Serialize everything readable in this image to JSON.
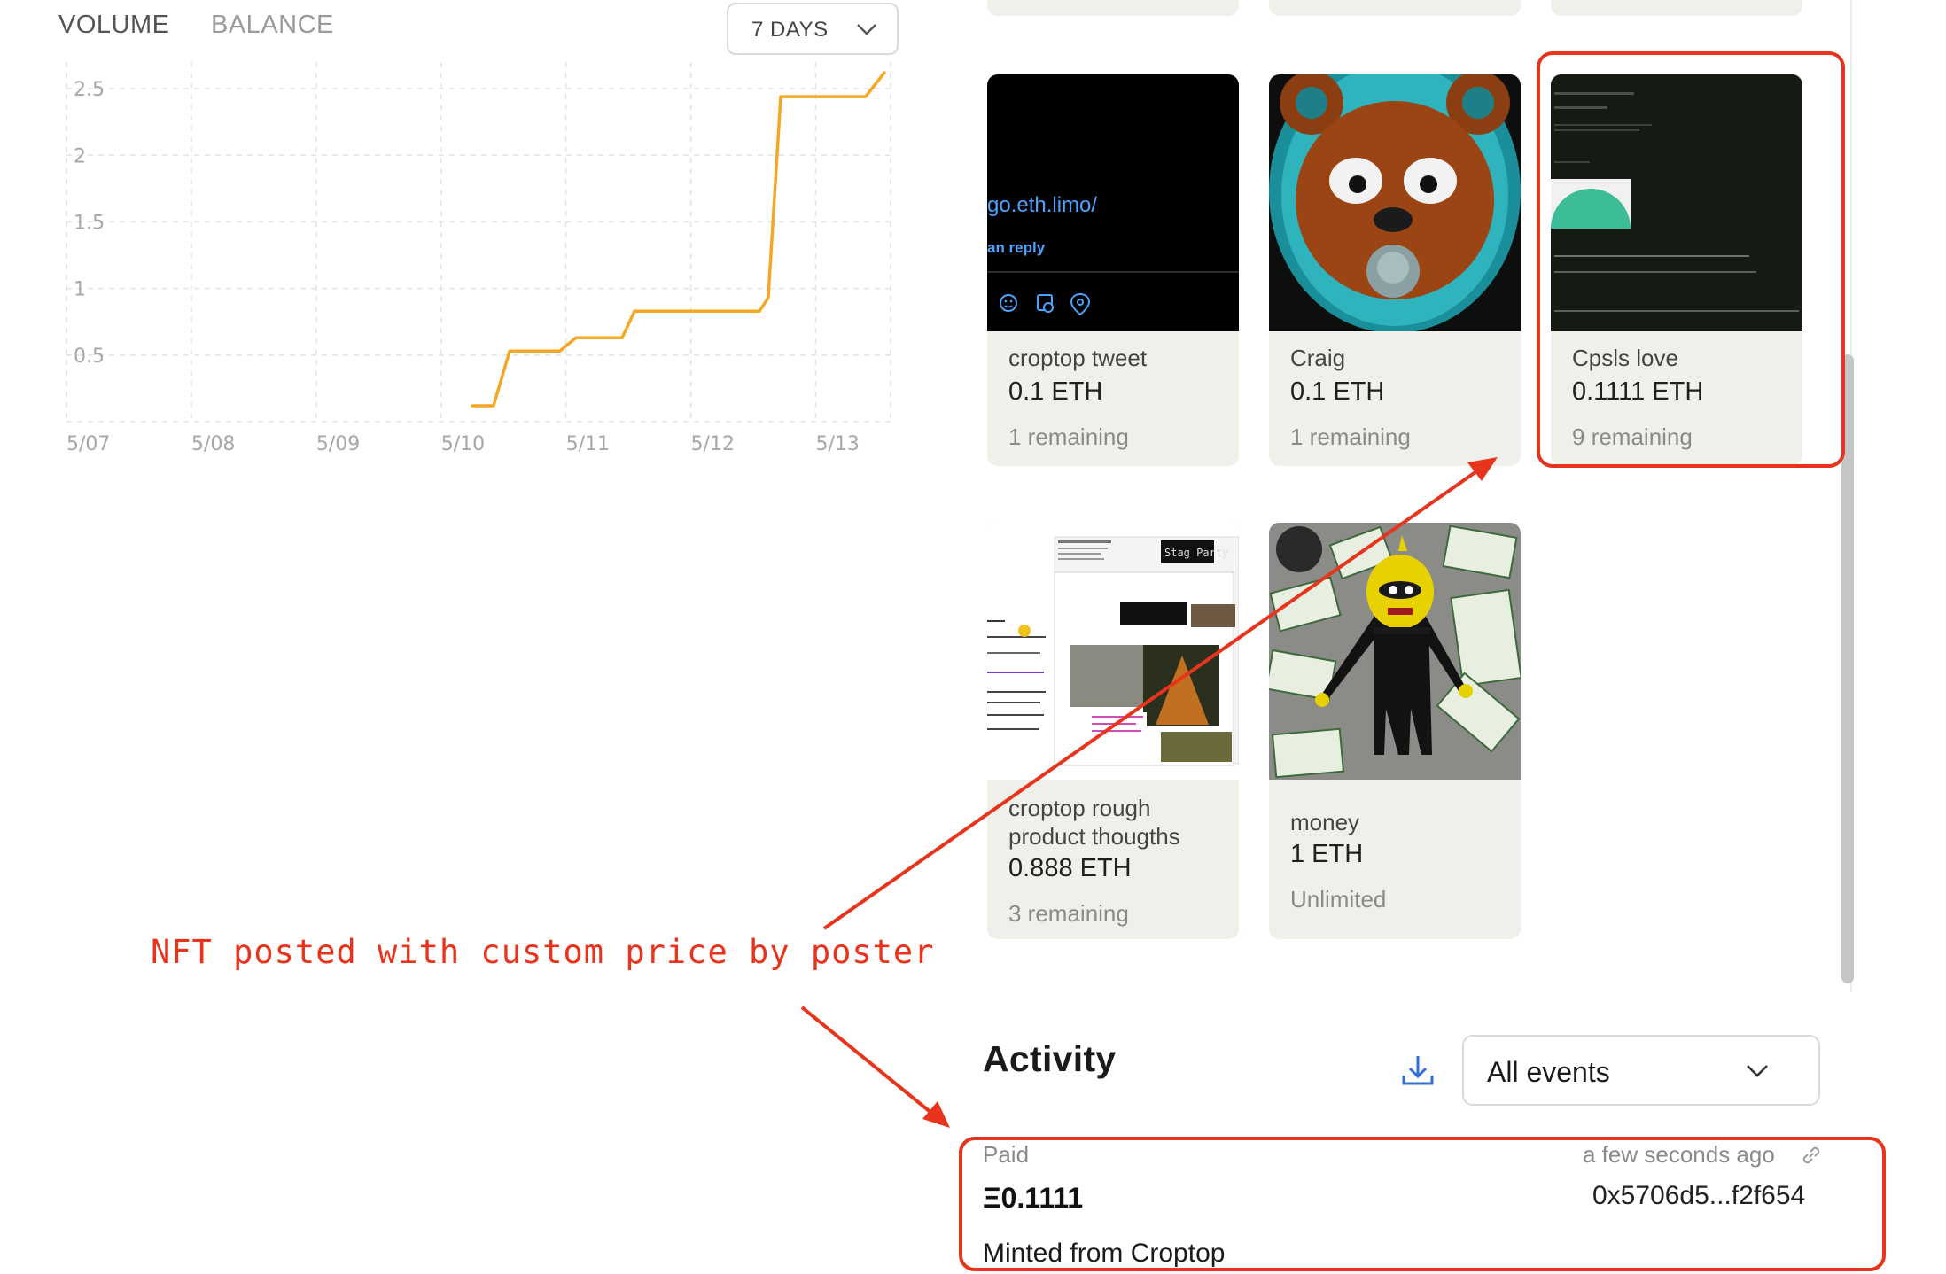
{
  "chart_panel": {
    "tabs": [
      {
        "label": "VOLUME"
      },
      {
        "label": "BALANCE"
      }
    ],
    "range": "7 DAYS"
  },
  "chart_data": {
    "type": "line",
    "title": "",
    "xlabel": "",
    "ylabel": "",
    "x_tick_labels": [
      "5/07",
      "5/08",
      "5/09",
      "5/10",
      "5/11",
      "5/12",
      "5/13"
    ],
    "y_ticks": [
      0.5,
      1,
      1.5,
      2,
      2.5
    ],
    "y_tick_labels": [
      "0.5",
      "1",
      "1.5",
      "2",
      "2.5"
    ],
    "xlim": [
      0,
      6.6
    ],
    "ylim": [
      0,
      2.7
    ],
    "grid": true,
    "line_color": "#f5a623",
    "series": [
      {
        "x": [
          3.25,
          3.42,
          3.55,
          3.95,
          4.08,
          4.45,
          4.55,
          5.55,
          5.62,
          5.72,
          6.4,
          6.55
        ],
        "y": [
          0.12,
          0.12,
          0.53,
          0.53,
          0.63,
          0.63,
          0.83,
          0.83,
          0.93,
          2.44,
          2.44,
          2.62
        ]
      }
    ]
  },
  "nft_grid": {
    "cards": [
      {
        "name": "croptop tweet",
        "price": "0.1 ETH",
        "remaining": "1 remaining",
        "thumb_url_text": "go.eth.limo/",
        "thumb_reply_text": "an reply"
      },
      {
        "name": "Craig",
        "price": "0.1 ETH",
        "remaining": "1 remaining"
      },
      {
        "name": "Cpsls love",
        "price": "0.1111 ETH",
        "remaining": "9 remaining"
      },
      {
        "name": "croptop rough product thougths",
        "price": "0.888 ETH",
        "remaining": "3 remaining",
        "thumb_banner_text": "Stag Party"
      },
      {
        "name": "money",
        "price": "1 ETH",
        "remaining": "Unlimited"
      }
    ]
  },
  "activity": {
    "title": "Activity",
    "filter": "All events",
    "entry": {
      "kind": "Paid",
      "time": "a few seconds ago",
      "amount": "Ξ0.1111",
      "address": "0x5706d5...f2f654",
      "note": "Minted from Croptop"
    }
  },
  "annotation": {
    "text": "NFT posted with custom price by poster",
    "color": "#e8341c"
  }
}
